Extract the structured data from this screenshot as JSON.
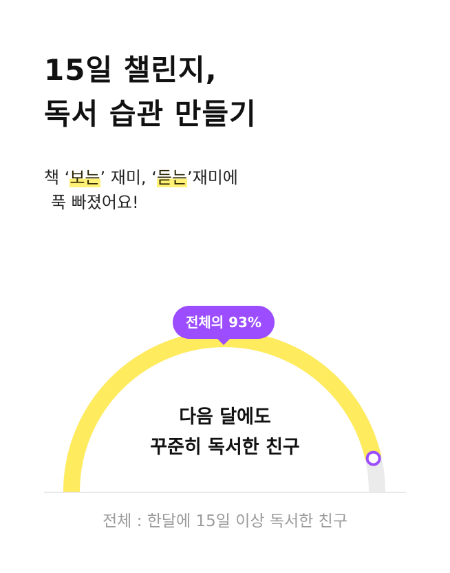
{
  "heading": {
    "line1": "15일 챌린지,",
    "line2": "독서 습관 만들기"
  },
  "subtitle": {
    "prefix": "책 ‘",
    "highlight1": "보는",
    "middle": "’ 재미, ‘",
    "highlight2": "듣는",
    "suffix": "’재미에",
    "line2": "푹 빠졌어요!"
  },
  "gauge": {
    "badge_label": "전체의 93%",
    "percent": 93,
    "center_line1": "다음 달에도",
    "center_line2": "꾸준히 독서한 친구",
    "colors": {
      "fill": "#ffeb5e",
      "track": "#ebebeb",
      "accent": "#9b4dff"
    }
  },
  "footnote": "전체 : 한달에 15일 이상 독서한 친구"
}
